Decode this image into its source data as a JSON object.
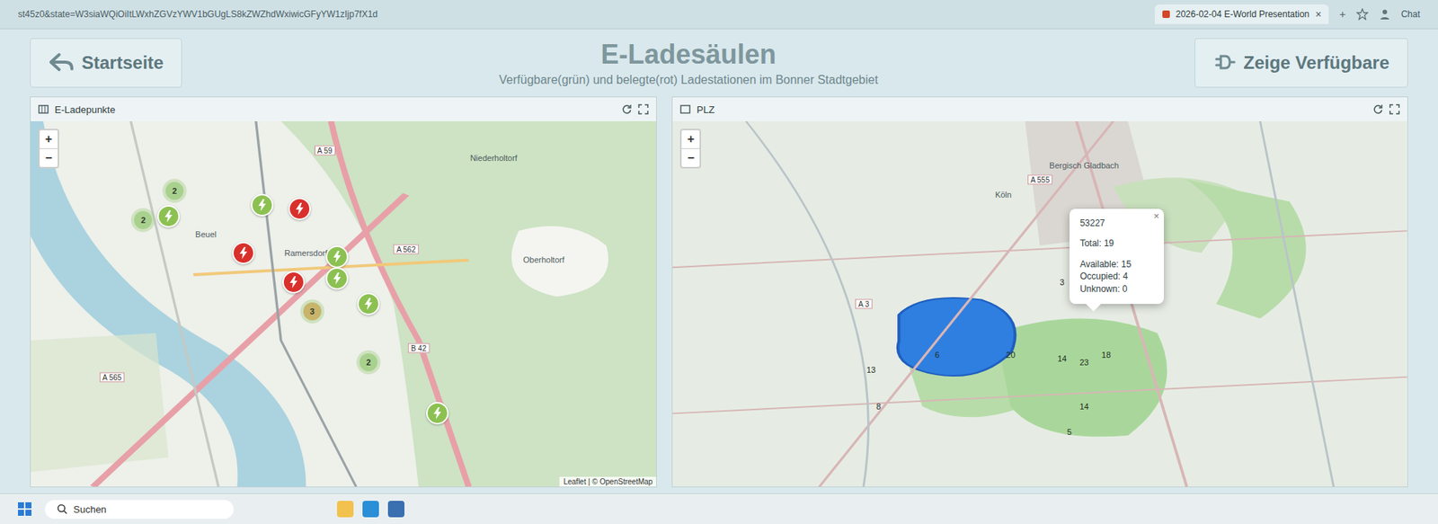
{
  "browser": {
    "url": "st45z0&state=W3siaWQiOiItLWxhZGVzYWV1bGUgLS8kZWZhdWxiwicGFyYW1zIjp7fX1d",
    "tab_title": "2026-02-04 E-World Presentation",
    "tab_close": "×",
    "new_tab": "+",
    "chat": "Chat"
  },
  "app": {
    "home_button": "Startseite",
    "title": "E-Ladesäulen",
    "subtitle": "Verfügbare(grün) und belegte(rot) Ladestationen im Bonner Stadtgebiet",
    "filter_button": "Zeige Verfügbare"
  },
  "left_map": {
    "title": "E-Ladepunkte",
    "zoom": [
      "+",
      "−"
    ],
    "markers": [
      {
        "available": true,
        "color": "#8cc152"
      },
      {
        "available": true,
        "color": "#8cc152"
      },
      {
        "available": false,
        "color": "#d9302b"
      },
      {
        "available": false,
        "color": "#d9302b"
      },
      {
        "available": true,
        "color": "#8cc152"
      },
      {
        "available": false,
        "color": "#d9302b"
      },
      {
        "available": true,
        "color": "#8cc152"
      },
      {
        "available": true,
        "color": "#8cc152"
      },
      {
        "available": true,
        "color": "#8cc152"
      }
    ],
    "clusters": [
      {
        "count": "2",
        "color": "#a9d18e"
      },
      {
        "count": "2",
        "color": "#a9d18e"
      },
      {
        "count": "3",
        "color": "#c8b46a"
      },
      {
        "count": "2",
        "color": "#a9d18e"
      }
    ],
    "road_labels": [
      "A 59",
      "A 562",
      "A 565",
      "B 42"
    ],
    "place_labels": [
      "Beuel",
      "Ramersdorf",
      "Niederholtorf",
      "Oberholtorf"
    ],
    "attribution": "Leaflet | © OpenStreetMap"
  },
  "right_map": {
    "title": "PLZ",
    "zoom": [
      "+",
      "−"
    ],
    "place_labels": [
      "Köln",
      "Bergisch Gladbach"
    ],
    "road_labels": [
      "A 3",
      "A 555"
    ],
    "regions": [
      {
        "count": "20"
      },
      {
        "count": "14"
      },
      {
        "count": "23"
      },
      {
        "count": "18"
      },
      {
        "count": "13"
      },
      {
        "count": "8"
      },
      {
        "count": "6"
      },
      {
        "count": "14"
      },
      {
        "count": "5"
      },
      {
        "count": "3"
      }
    ],
    "popup": {
      "plz": "53227",
      "close": "×",
      "lines": [
        "Total: 19",
        "Available: 15",
        "Occupied: 4",
        "Unknown: 0"
      ]
    }
  },
  "taskbar": {
    "search": "Suchen"
  }
}
